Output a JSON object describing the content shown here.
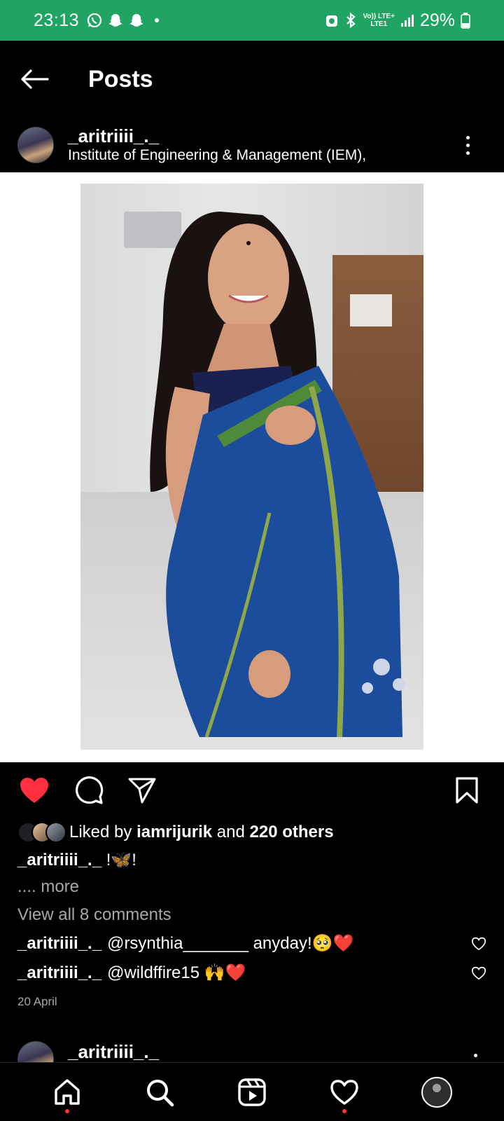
{
  "status_bar": {
    "time": "23:13",
    "network_top": "Vo)) LTE+",
    "network_bottom": "LTE1",
    "battery": "29%",
    "left_icons": [
      "whatsapp-icon",
      "snapchat-icon",
      "snapchat-icon",
      "dot-icon"
    ],
    "right_icons": [
      "alarm-icon",
      "bluetooth-icon",
      "signal-icon",
      "battery-icon"
    ]
  },
  "header": {
    "title": "Posts"
  },
  "post": {
    "username": "_aritriiii_._",
    "location": "Institute of Engineering & Management (IEM),",
    "liked": true,
    "likes": {
      "prefix": "Liked by",
      "liker": "iamrijurik",
      "connector": "and",
      "others": "220 others"
    },
    "caption": {
      "username": "_aritriiii_._",
      "text": "!🦋!"
    },
    "more": ".... more",
    "view_comments": "View all 8 comments",
    "comments": [
      {
        "username": "_aritriiii_._",
        "text": "@rsynthia_______ anyday!🥺❤️"
      },
      {
        "username": "_aritriiii_._",
        "text": "@wildffire15 🙌❤️"
      }
    ],
    "date": "20 April"
  },
  "next_post": {
    "username": "_aritriiii_._"
  },
  "colors": {
    "status_bar": "#1fa463",
    "like_red": "#ff3040",
    "muted_text": "#a8a8a8"
  },
  "bottom_nav": [
    "home-icon",
    "search-icon",
    "reels-icon",
    "activity-heart-icon",
    "profile-avatar"
  ]
}
